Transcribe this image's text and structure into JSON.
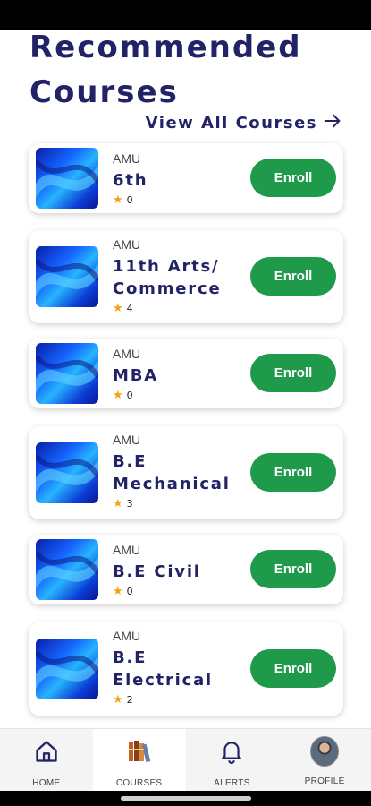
{
  "page": {
    "title": "Recommended Courses",
    "view_all_label": "View All Courses"
  },
  "courses": [
    {
      "provider": "AMU",
      "name": "6th",
      "rating": "0",
      "enroll_label": "Enroll"
    },
    {
      "provider": "AMU",
      "name": "11th Arts/ Commerce",
      "rating": "4",
      "enroll_label": "Enroll"
    },
    {
      "provider": "AMU",
      "name": "MBA",
      "rating": "0",
      "enroll_label": "Enroll"
    },
    {
      "provider": "AMU",
      "name": "B.E Mechanical",
      "rating": "3",
      "enroll_label": "Enroll"
    },
    {
      "provider": "AMU",
      "name": "B.E Civil",
      "rating": "0",
      "enroll_label": "Enroll"
    },
    {
      "provider": "AMU",
      "name": "B.E Electrical",
      "rating": "2",
      "enroll_label": "Enroll"
    }
  ],
  "nav": {
    "items": [
      {
        "label": "HOME",
        "icon": "home-icon"
      },
      {
        "label": "COURSES",
        "icon": "books-icon",
        "active": true
      },
      {
        "label": "ALERTS",
        "icon": "bell-icon"
      },
      {
        "label": "PROFILE",
        "icon": "avatar"
      }
    ]
  },
  "colors": {
    "title": "#222266",
    "enroll_button": "#1e9a4a",
    "star": "#f2a310",
    "nav_background": "#f4f4f5"
  }
}
